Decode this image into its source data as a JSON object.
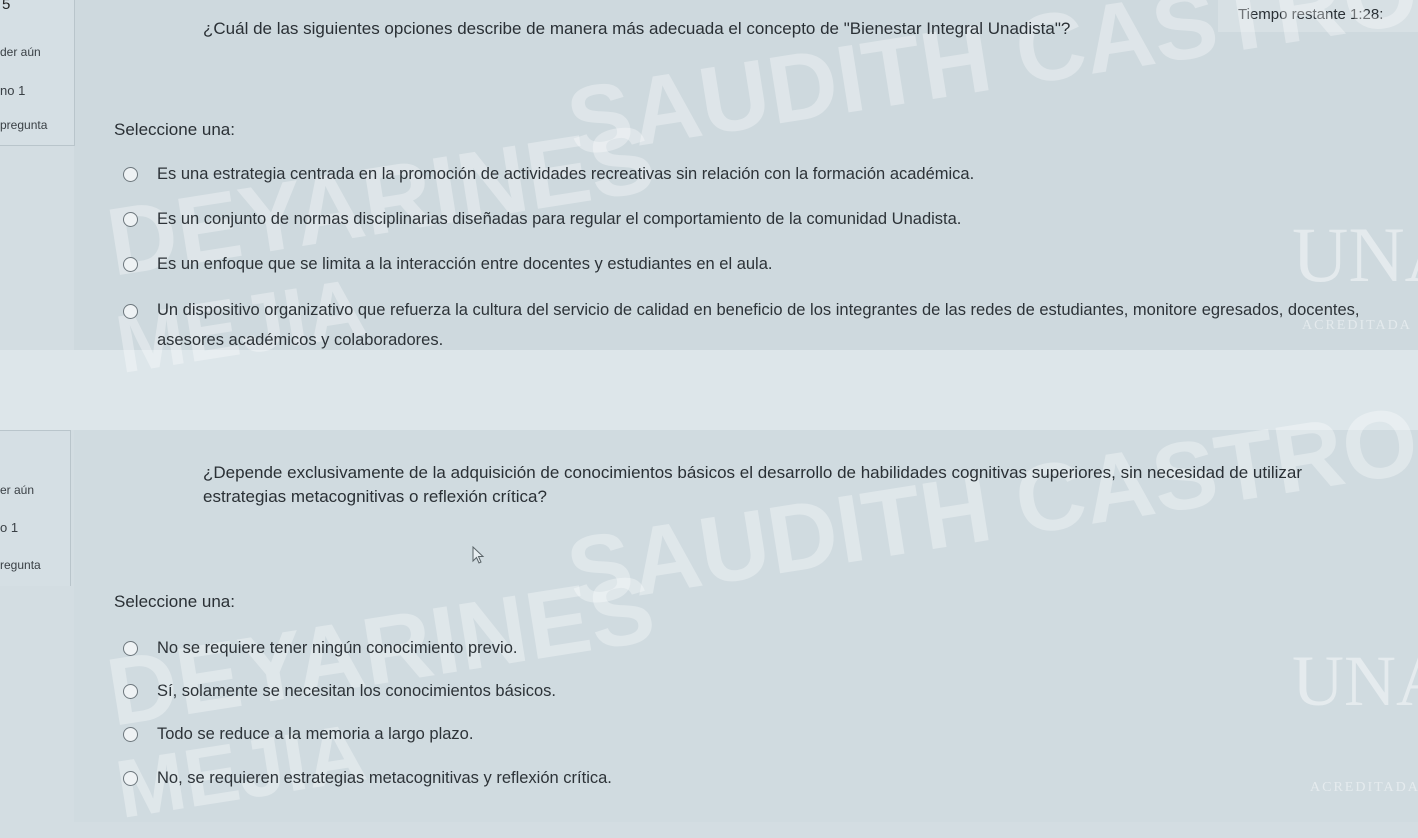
{
  "top_fragment": "5",
  "timer": {
    "label": "Tiempo restante 1:28:"
  },
  "question1": {
    "side": {
      "status": "der aún",
      "number": "no 1",
      "flag": "pregunta"
    },
    "text": "¿Cuál de las siguientes opciones describe de manera más adecuada el concepto de \"Bienestar Integral Unadista\"?",
    "select_label": "Seleccione una:",
    "options": [
      "Es una estrategia centrada en la promoción de actividades recreativas sin relación con la formación académica.",
      "Es un conjunto de normas disciplinarias diseñadas para regular el comportamiento de la comunidad Unadista.",
      "Es un enfoque que se limita a la interacción entre docentes y estudiantes en el aula.",
      "Un dispositivo organizativo que refuerza la cultura del servicio de calidad en beneficio de los integrantes de las redes de estudiantes, monitore egresados, docentes, asesores académicos y colaboradores."
    ]
  },
  "question2": {
    "side": {
      "status": "er aún",
      "number": "o 1",
      "flag": "regunta"
    },
    "text_line1": "¿Depende exclusivamente de la adquisición de conocimientos básicos el desarrollo de habilidades cognitivas superiores, sin necesidad de utilizar",
    "text_line2": "estrategias metacognitivas o reflexión crítica?",
    "select_label": "Seleccione una:",
    "options": [
      "No se requiere tener ningún conocimiento previo.",
      "Sí, solamente se necesitan los conocimientos básicos.",
      "Todo se reduce a la memoria a largo plazo.",
      "No, se requieren estrategias metacognitivas y reflexión crítica."
    ]
  },
  "watermark": {
    "line1": "SAUDITH CASTRO",
    "line2": "DEYARINES",
    "line3": "MEJIA"
  },
  "logo": {
    "mark": "UNAD",
    "accreditation": "ACREDITADA"
  }
}
